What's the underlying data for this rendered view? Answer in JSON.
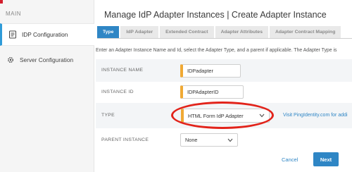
{
  "sidebar": {
    "heading": "MAIN",
    "items": [
      {
        "label": "IDP Configuration",
        "icon": "document-list-icon"
      },
      {
        "label": "Server Configuration",
        "icon": "gear-icon"
      }
    ]
  },
  "header": {
    "title": "Manage IdP Adapter Instances | Create Adapter Instance"
  },
  "tabs": [
    {
      "label": "Type"
    },
    {
      "label": "IdP Adapter"
    },
    {
      "label": "Extended Contract"
    },
    {
      "label": "Adapter Attributes"
    },
    {
      "label": "Adapter Contract Mapping"
    }
  ],
  "intro": "Enter an Adapter Instance Name and Id, select the Adapter Type, and a parent if applicable. The Adapter Type is",
  "form": {
    "instance_name": {
      "label": "INSTANCE NAME",
      "value": "IDPadapter"
    },
    "instance_id": {
      "label": "INSTANCE ID",
      "value": "IDPAdapterID"
    },
    "type": {
      "label": "TYPE",
      "value": "HTML Form IdP Adapter",
      "link": "Visit PingIdentity.com for addi"
    },
    "parent_instance": {
      "label": "PARENT INSTANCE",
      "value": "None"
    }
  },
  "footer": {
    "cancel_label": "Cancel",
    "next_label": "Next"
  },
  "colors": {
    "accent": "#2f86c5",
    "required_marker": "#f0a934",
    "highlight": "#e2231a",
    "brand": "#d31d2c"
  }
}
